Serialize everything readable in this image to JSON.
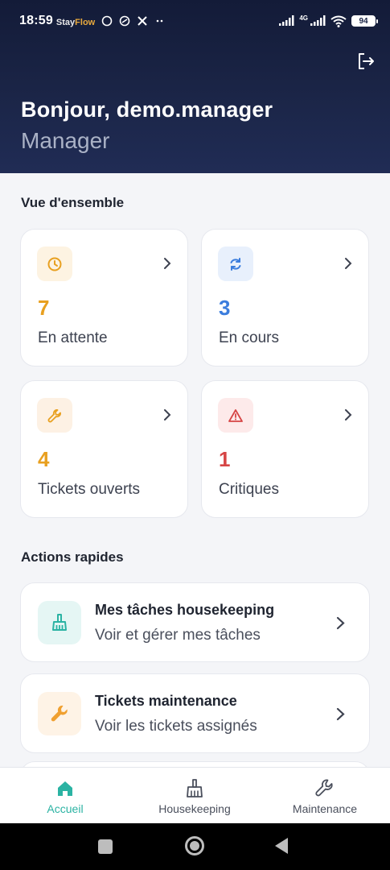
{
  "statusbar": {
    "time": "18:59",
    "app_name_white": "Stay",
    "app_name_accent": "Flow",
    "network": "4G",
    "battery": "94"
  },
  "header": {
    "greeting": "Bonjour, demo.manager",
    "role": "Manager"
  },
  "overview": {
    "title": "Vue d'ensemble",
    "cards": [
      {
        "value": "7",
        "label": "En attente",
        "icon": "clock-icon",
        "color": "#e8a020",
        "bg": "#fdf3e2"
      },
      {
        "value": "3",
        "label": "En cours",
        "icon": "refresh-icon",
        "color": "#3b7ddd",
        "bg": "#e8f0fc"
      },
      {
        "value": "4",
        "label": "Tickets ouverts",
        "icon": "wrench-icon",
        "color": "#e8a020",
        "bg": "#fdf1e4"
      },
      {
        "value": "1",
        "label": "Critiques",
        "icon": "alert-triangle-icon",
        "color": "#d64545",
        "bg": "#fdeaea"
      }
    ]
  },
  "quick_actions": {
    "title": "Actions rapides",
    "items": [
      {
        "title": "Mes tâches housekeeping",
        "subtitle": "Voir et gérer mes tâches",
        "icon": "broom-icon",
        "color": "#2bb3a3",
        "bg": "#e5f6f4"
      },
      {
        "title": "Tickets maintenance",
        "subtitle": "Voir les tickets assignés",
        "icon": "wrench-icon",
        "color": "#f0a030",
        "bg": "#fef3e6"
      }
    ]
  },
  "bottom_nav": {
    "items": [
      {
        "label": "Accueil",
        "icon": "home-icon",
        "active": true
      },
      {
        "label": "Housekeeping",
        "icon": "broom-icon",
        "active": false
      },
      {
        "label": "Maintenance",
        "icon": "wrench-icon",
        "active": false
      }
    ],
    "active_color": "#2bb3a3",
    "inactive_color": "#4a4f5c"
  }
}
